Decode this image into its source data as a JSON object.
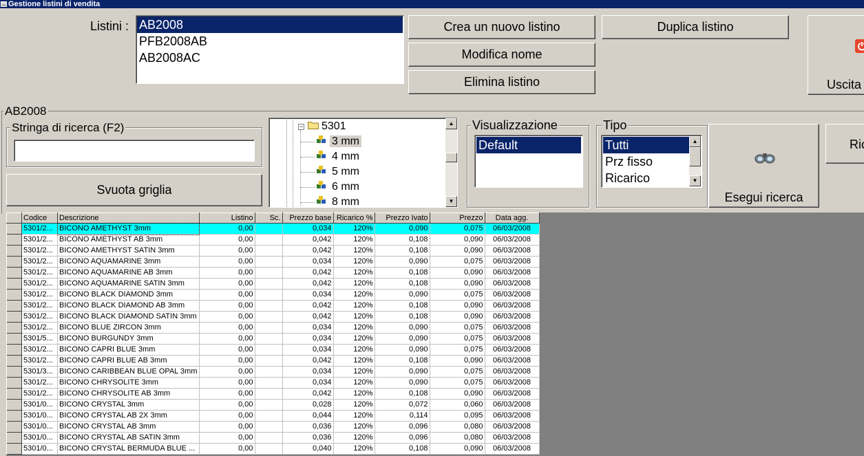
{
  "window": {
    "title": "Gestione listini di vendita"
  },
  "listini": {
    "label": "Listini :",
    "items": [
      "AB2008",
      "PFB2008AB",
      "AB2008AC"
    ],
    "selected_index": 0
  },
  "buttons": {
    "create": "Crea un nuovo listino",
    "duplicate": "Duplica listino",
    "rename": "Modifica nome",
    "delete": "Elimina listino",
    "exit": "Uscita",
    "clear_grid": "Svuota griglia",
    "search": "Esegui ricerca",
    "right_partial": "Ric"
  },
  "current_list_title": "AB2008",
  "search": {
    "label": "Stringa di ricerca (F2)",
    "value": ""
  },
  "tree": {
    "parent": "5301",
    "children": [
      "3 mm",
      "4 mm",
      "5 mm",
      "6 mm",
      "8 mm"
    ],
    "selected_child": "3 mm"
  },
  "visualizzazione": {
    "label": "Visualizzazione",
    "items": [
      "Default"
    ],
    "selected": "Default"
  },
  "tipo": {
    "label": "Tipo",
    "items": [
      "Tutti",
      "Prz fisso",
      "Ricarico"
    ],
    "selected": "Tutti"
  },
  "grid": {
    "columns": [
      "Codice",
      "Descrizione",
      "Listino",
      "Sc.",
      "Prezzo base",
      "Ricarico %",
      "Prezzo Ivato",
      "Prezzo",
      "Data agg."
    ],
    "rows": [
      [
        "5301/2...",
        "BICONO AMETHYST 3mm",
        "0,00",
        "",
        "0,034",
        "120%",
        "0,090",
        "0,075",
        "06/03/2008"
      ],
      [
        "5301/2...",
        "BICONO AMETHYST AB 3mm",
        "0,00",
        "",
        "0,042",
        "120%",
        "0,108",
        "0,090",
        "06/03/2008"
      ],
      [
        "5301/2...",
        "BICONO AMETHYST SATIN 3mm",
        "0,00",
        "",
        "0,042",
        "120%",
        "0,108",
        "0,090",
        "06/03/2008"
      ],
      [
        "5301/2...",
        "BICONO AQUAMARINE 3mm",
        "0,00",
        "",
        "0,034",
        "120%",
        "0,090",
        "0,075",
        "06/03/2008"
      ],
      [
        "5301/2...",
        "BICONO AQUAMARINE AB 3mm",
        "0,00",
        "",
        "0,042",
        "120%",
        "0,108",
        "0,090",
        "06/03/2008"
      ],
      [
        "5301/2...",
        "BICONO AQUAMARINE SATIN 3mm",
        "0,00",
        "",
        "0,042",
        "120%",
        "0,108",
        "0,090",
        "06/03/2008"
      ],
      [
        "5301/2...",
        "BICONO BLACK DIAMOND 3mm",
        "0,00",
        "",
        "0,034",
        "120%",
        "0,090",
        "0,075",
        "06/03/2008"
      ],
      [
        "5301/2...",
        "BICONO BLACK DIAMOND AB 3mm",
        "0,00",
        "",
        "0,042",
        "120%",
        "0,108",
        "0,090",
        "06/03/2008"
      ],
      [
        "5301/2...",
        "BICONO BLACK DIAMOND SATIN 3mm",
        "0,00",
        "",
        "0,042",
        "120%",
        "0,108",
        "0,090",
        "06/03/2008"
      ],
      [
        "5301/2...",
        "BICONO BLUE ZIRCON 3mm",
        "0,00",
        "",
        "0,034",
        "120%",
        "0,090",
        "0,075",
        "06/03/2008"
      ],
      [
        "5301/5...",
        "BICONO BURGUNDY 3mm",
        "0,00",
        "",
        "0,034",
        "120%",
        "0,090",
        "0,075",
        "06/03/2008"
      ],
      [
        "5301/2...",
        "BICONO CAPRI BLUE 3mm",
        "0,00",
        "",
        "0,034",
        "120%",
        "0,090",
        "0,075",
        "06/03/2008"
      ],
      [
        "5301/2...",
        "BICONO CAPRI BLUE AB 3mm",
        "0,00",
        "",
        "0,042",
        "120%",
        "0,108",
        "0,090",
        "06/03/2008"
      ],
      [
        "5301/3...",
        "BICONO CARIBBEAN BLUE OPAL 3mm",
        "0,00",
        "",
        "0,034",
        "120%",
        "0,090",
        "0,075",
        "06/03/2008"
      ],
      [
        "5301/2...",
        "BICONO CHRYSOLITE 3mm",
        "0,00",
        "",
        "0,034",
        "120%",
        "0,090",
        "0,075",
        "06/03/2008"
      ],
      [
        "5301/2...",
        "BICONO CHRYSOLITE AB 3mm",
        "0,00",
        "",
        "0,042",
        "120%",
        "0,108",
        "0,090",
        "06/03/2008"
      ],
      [
        "5301/0...",
        "BICONO CRYSTAL 3mm",
        "0,00",
        "",
        "0,028",
        "120%",
        "0,072",
        "0,060",
        "06/03/2008"
      ],
      [
        "5301/0...",
        "BICONO CRYSTAL AB 2X 3mm",
        "0,00",
        "",
        "0,044",
        "120%",
        "0,114",
        "0,095",
        "06/03/2008"
      ],
      [
        "5301/0...",
        "BICONO CRYSTAL AB 3mm",
        "0,00",
        "",
        "0,036",
        "120%",
        "0,096",
        "0,080",
        "06/03/2008"
      ],
      [
        "5301/0...",
        "BICONO CRYSTAL AB SATIN 3mm",
        "0,00",
        "",
        "0,036",
        "120%",
        "0,096",
        "0,080",
        "06/03/2008"
      ],
      [
        "5301/0...",
        "BICONO CRYSTAL BERMUDA BLUE ...",
        "0,00",
        "",
        "0,040",
        "120%",
        "0,108",
        "0,090",
        "06/03/2008"
      ]
    ],
    "highlighted_row": 0
  },
  "colors": {
    "window_bg": "#d4d0c8",
    "selection": "#0a246a",
    "row_highlight": "#00ffff",
    "grid_empty_area": "#808080",
    "exit_icon": "#e8452c"
  },
  "icons": {
    "app": "app-window-icon",
    "exit": "power-exit-icon",
    "search": "binoculars-icon",
    "folder": "folder-icon",
    "item": "blocks-icon"
  }
}
